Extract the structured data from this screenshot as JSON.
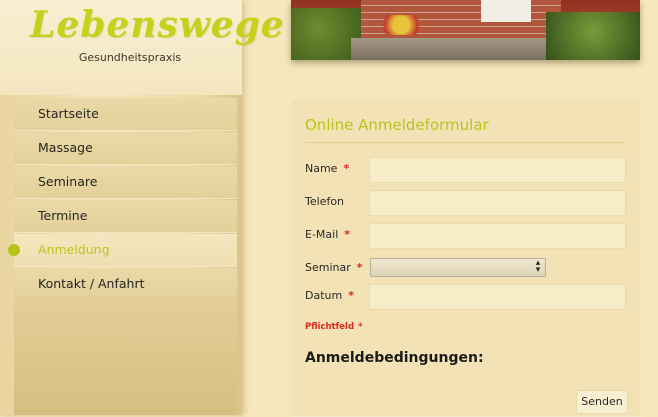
{
  "brand": {
    "logo_text": "Lebenswege",
    "subtitle": "Gesundheitspraxis"
  },
  "nav": {
    "items": [
      {
        "label": "Startseite",
        "active": false
      },
      {
        "label": "Massage",
        "active": false
      },
      {
        "label": "Seminare",
        "active": false
      },
      {
        "label": "Termine",
        "active": false
      },
      {
        "label": "Anmeldung",
        "active": true
      },
      {
        "label": "Kontakt / Anfahrt",
        "active": false
      }
    ]
  },
  "form": {
    "title": "Online Anmeldeformular",
    "fields": {
      "name": {
        "label": "Name",
        "required_mark": "*",
        "value": ""
      },
      "telefon": {
        "label": "Telefon",
        "value": ""
      },
      "email": {
        "label": "E-Mail",
        "required_mark": "*",
        "value": ""
      },
      "seminar": {
        "label": "Seminar",
        "required_mark": "*",
        "selected": ""
      },
      "datum": {
        "label": "Datum",
        "required_mark": "*",
        "value": ""
      }
    },
    "required_hint": "Pflichtfeld",
    "required_hint_mark": "*",
    "terms_heading": "Anmeldebedingungen:",
    "submit_label": "Senden"
  },
  "colors": {
    "accent_green": "#b7c51e",
    "required_red": "#d62a1e",
    "background": "#f6e7bd"
  }
}
